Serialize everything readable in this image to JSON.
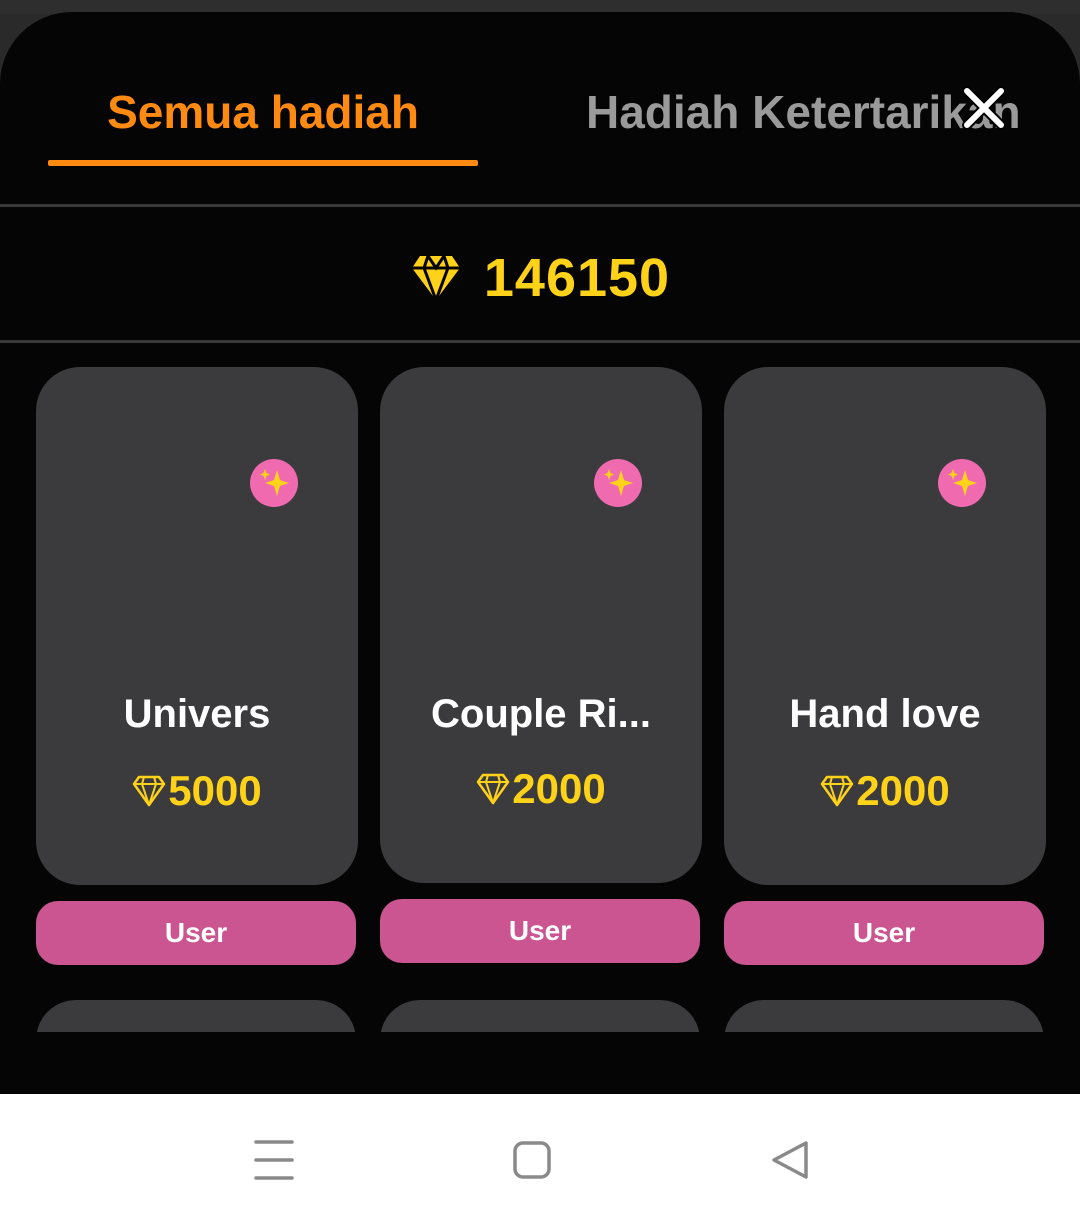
{
  "tabs": {
    "all_gifts": "Semua hadiah",
    "attraction_gifts": "Hadiah Ketertarikan"
  },
  "balance": {
    "icon": "diamond-icon",
    "value": "146150"
  },
  "gifts": [
    {
      "name": "Univers",
      "price": "5000",
      "badge_icon": "sparkles-icon",
      "button_label": "User"
    },
    {
      "name": "Couple Ri...",
      "price": "2000",
      "badge_icon": "sparkles-icon",
      "button_label": "User"
    },
    {
      "name": "Hand love",
      "price": "2000",
      "badge_icon": "sparkles-icon",
      "button_label": "User"
    }
  ],
  "navbar": {
    "icons": [
      "menu-icon",
      "home-icon",
      "back-icon"
    ]
  },
  "colors": {
    "accent_orange": "#ff8a12",
    "diamond_yellow": "#ffd21a",
    "button_pink": "#cb5591",
    "badge_pink": "#f06ab0",
    "card_bg": "#3b3b3d",
    "sheet_bg": "#050505"
  }
}
